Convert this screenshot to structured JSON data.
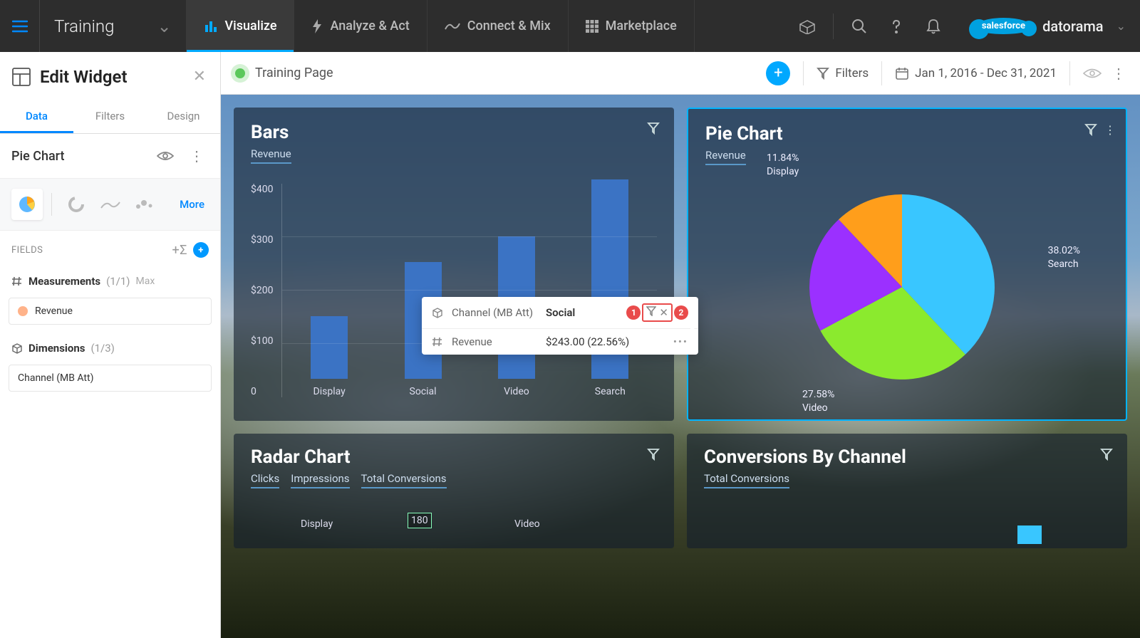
{
  "nav": {
    "brand": "Training",
    "tabs": [
      "Visualize",
      "Analyze & Act",
      "Connect & Mix",
      "Marketplace"
    ],
    "activeTab": 0,
    "logo_sf": "salesforce",
    "logo_name": "datorama"
  },
  "sidebar": {
    "title": "Edit Widget",
    "tabs": [
      "Data",
      "Filters",
      "Design"
    ],
    "activeTab": 0,
    "chartTypeTitle": "Pie Chart",
    "moreLabel": "More",
    "fieldsLabel": "FIELDS",
    "measurements": {
      "label": "Measurements",
      "count": "(1/1)",
      "max": "Max",
      "items": [
        "Revenue"
      ]
    },
    "dimensions": {
      "label": "Dimensions",
      "count": "(1/3)",
      "items": [
        "Channel (MB Att)"
      ]
    }
  },
  "pagebar": {
    "title": "Training Page",
    "filters": "Filters",
    "daterange": "Jan 1, 2016 - Dec 31, 2021"
  },
  "widgets": {
    "bars": {
      "title": "Bars",
      "sub": "Revenue"
    },
    "pie": {
      "title": "Pie Chart",
      "sub": "Revenue",
      "labels": {
        "display": "11.84%\nDisplay",
        "search": "38.02%\nSearch",
        "social": "27.58%\nVideo"
      }
    },
    "radar": {
      "title": "Radar Chart",
      "subs": [
        "Clicks",
        "Impressions",
        "Total Conversions"
      ],
      "labels": {
        "display": "Display",
        "num": "180",
        "video": "Video"
      }
    },
    "conv": {
      "title": "Conversions By Channel",
      "subs": [
        "Total Conversions"
      ]
    }
  },
  "tooltip": {
    "row1key": "Channel (MB Att)",
    "row1val": "Social",
    "row2key": "Revenue",
    "row2val": "$243.00 (22.56%)",
    "badge1": "1",
    "badge2": "2"
  },
  "chart_data": [
    {
      "type": "bar",
      "title": "Bars",
      "ylabel": "Revenue",
      "ylim": [
        0,
        440
      ],
      "yticks": [
        0,
        100,
        200,
        300,
        400
      ],
      "categories": [
        "Display",
        "Social",
        "Video",
        "Search"
      ],
      "values": [
        130,
        240,
        295,
        410
      ]
    },
    {
      "type": "pie",
      "title": "Pie Chart",
      "series": [
        {
          "name": "Search",
          "value": 38.02,
          "color": "#39c6ff"
        },
        {
          "name": "Video",
          "value": 27.58,
          "color": "#8bea2e"
        },
        {
          "name": "Social",
          "value": 22.56,
          "color": "#9b30ff"
        },
        {
          "name": "Display",
          "value": 11.84,
          "color": "#ff9e1b"
        }
      ]
    }
  ]
}
